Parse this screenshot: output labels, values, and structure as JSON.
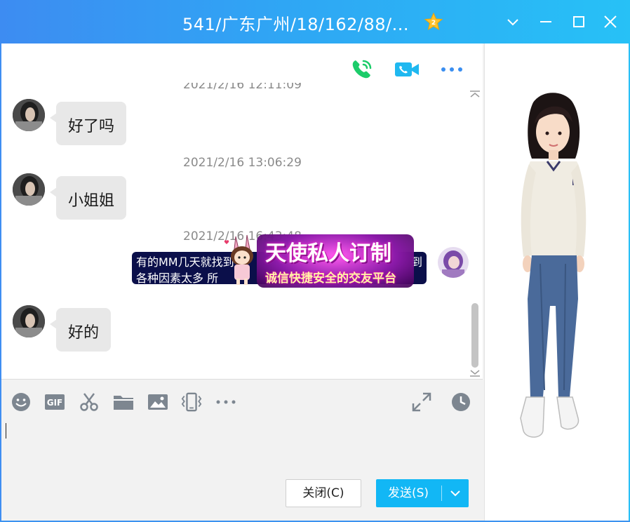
{
  "window": {
    "title": "541/广东广州/18/162/88/...",
    "accent_color": "#12b7f5"
  },
  "header": {
    "icons": [
      "voice-call-icon",
      "video-call-icon",
      "more-options-icon"
    ]
  },
  "messages": [
    {
      "timestamp": "2021/2/16 12:11:09",
      "text": "好了吗",
      "from": "contact"
    },
    {
      "timestamp": "2021/2/16 13:06:29",
      "text": "小姐姐",
      "from": "contact"
    },
    {
      "timestamp": "2021/2/16 16:43:48",
      "from": "self",
      "sticker": {
        "line1": "有的MM几天就找到",
        "line1_end": "到",
        "line2": "各种因素太多 所",
        "title": "天使私人订制",
        "subtitle": "诚信快捷安全的交友平台"
      }
    },
    {
      "timestamp": "",
      "text": "好的",
      "from": "contact"
    }
  ],
  "toolbar": {
    "icons": [
      "emoji-icon",
      "gif-icon",
      "screenshot-scissors-icon",
      "folder-icon",
      "image-icon",
      "shake-window-icon",
      "more-tools-icon"
    ],
    "right_icons": [
      "expand-icon",
      "history-clock-icon"
    ]
  },
  "input": {
    "value": ""
  },
  "buttons": {
    "close_label": "关闭(C)",
    "send_label": "发送(S)"
  }
}
